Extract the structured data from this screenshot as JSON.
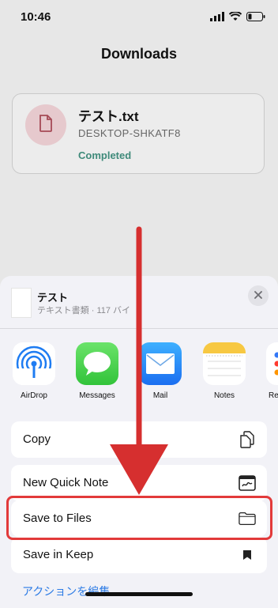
{
  "status": {
    "time": "10:46"
  },
  "nav": {
    "title": "Downloads"
  },
  "download": {
    "file_name": "テスト.txt",
    "source": "DESKTOP-SHKATF8",
    "status": "Completed"
  },
  "share_sheet": {
    "doc_title": "テスト",
    "doc_subtitle": "テキスト書類 · 117 バイ",
    "apps": [
      {
        "label": "AirDrop",
        "icon": "airdrop-icon"
      },
      {
        "label": "Messages",
        "icon": "messages-icon"
      },
      {
        "label": "Mail",
        "icon": "mail-icon"
      },
      {
        "label": "Notes",
        "icon": "notes-icon"
      },
      {
        "label": "Re",
        "icon": "reminders-icon"
      }
    ],
    "actions": [
      {
        "label": "Copy",
        "icon": "copy-icon"
      },
      {
        "label": "New Quick Note",
        "icon": "quick-note-icon"
      },
      {
        "label": "Save to Files",
        "icon": "folder-icon"
      },
      {
        "label": "Save in Keep",
        "icon": "bookmark-icon"
      }
    ],
    "edit_link": "アクションを編集..."
  },
  "colors": {
    "status_completed": "#3f8a7a",
    "highlight": "#e23a3a",
    "link": "#2c7be5"
  }
}
